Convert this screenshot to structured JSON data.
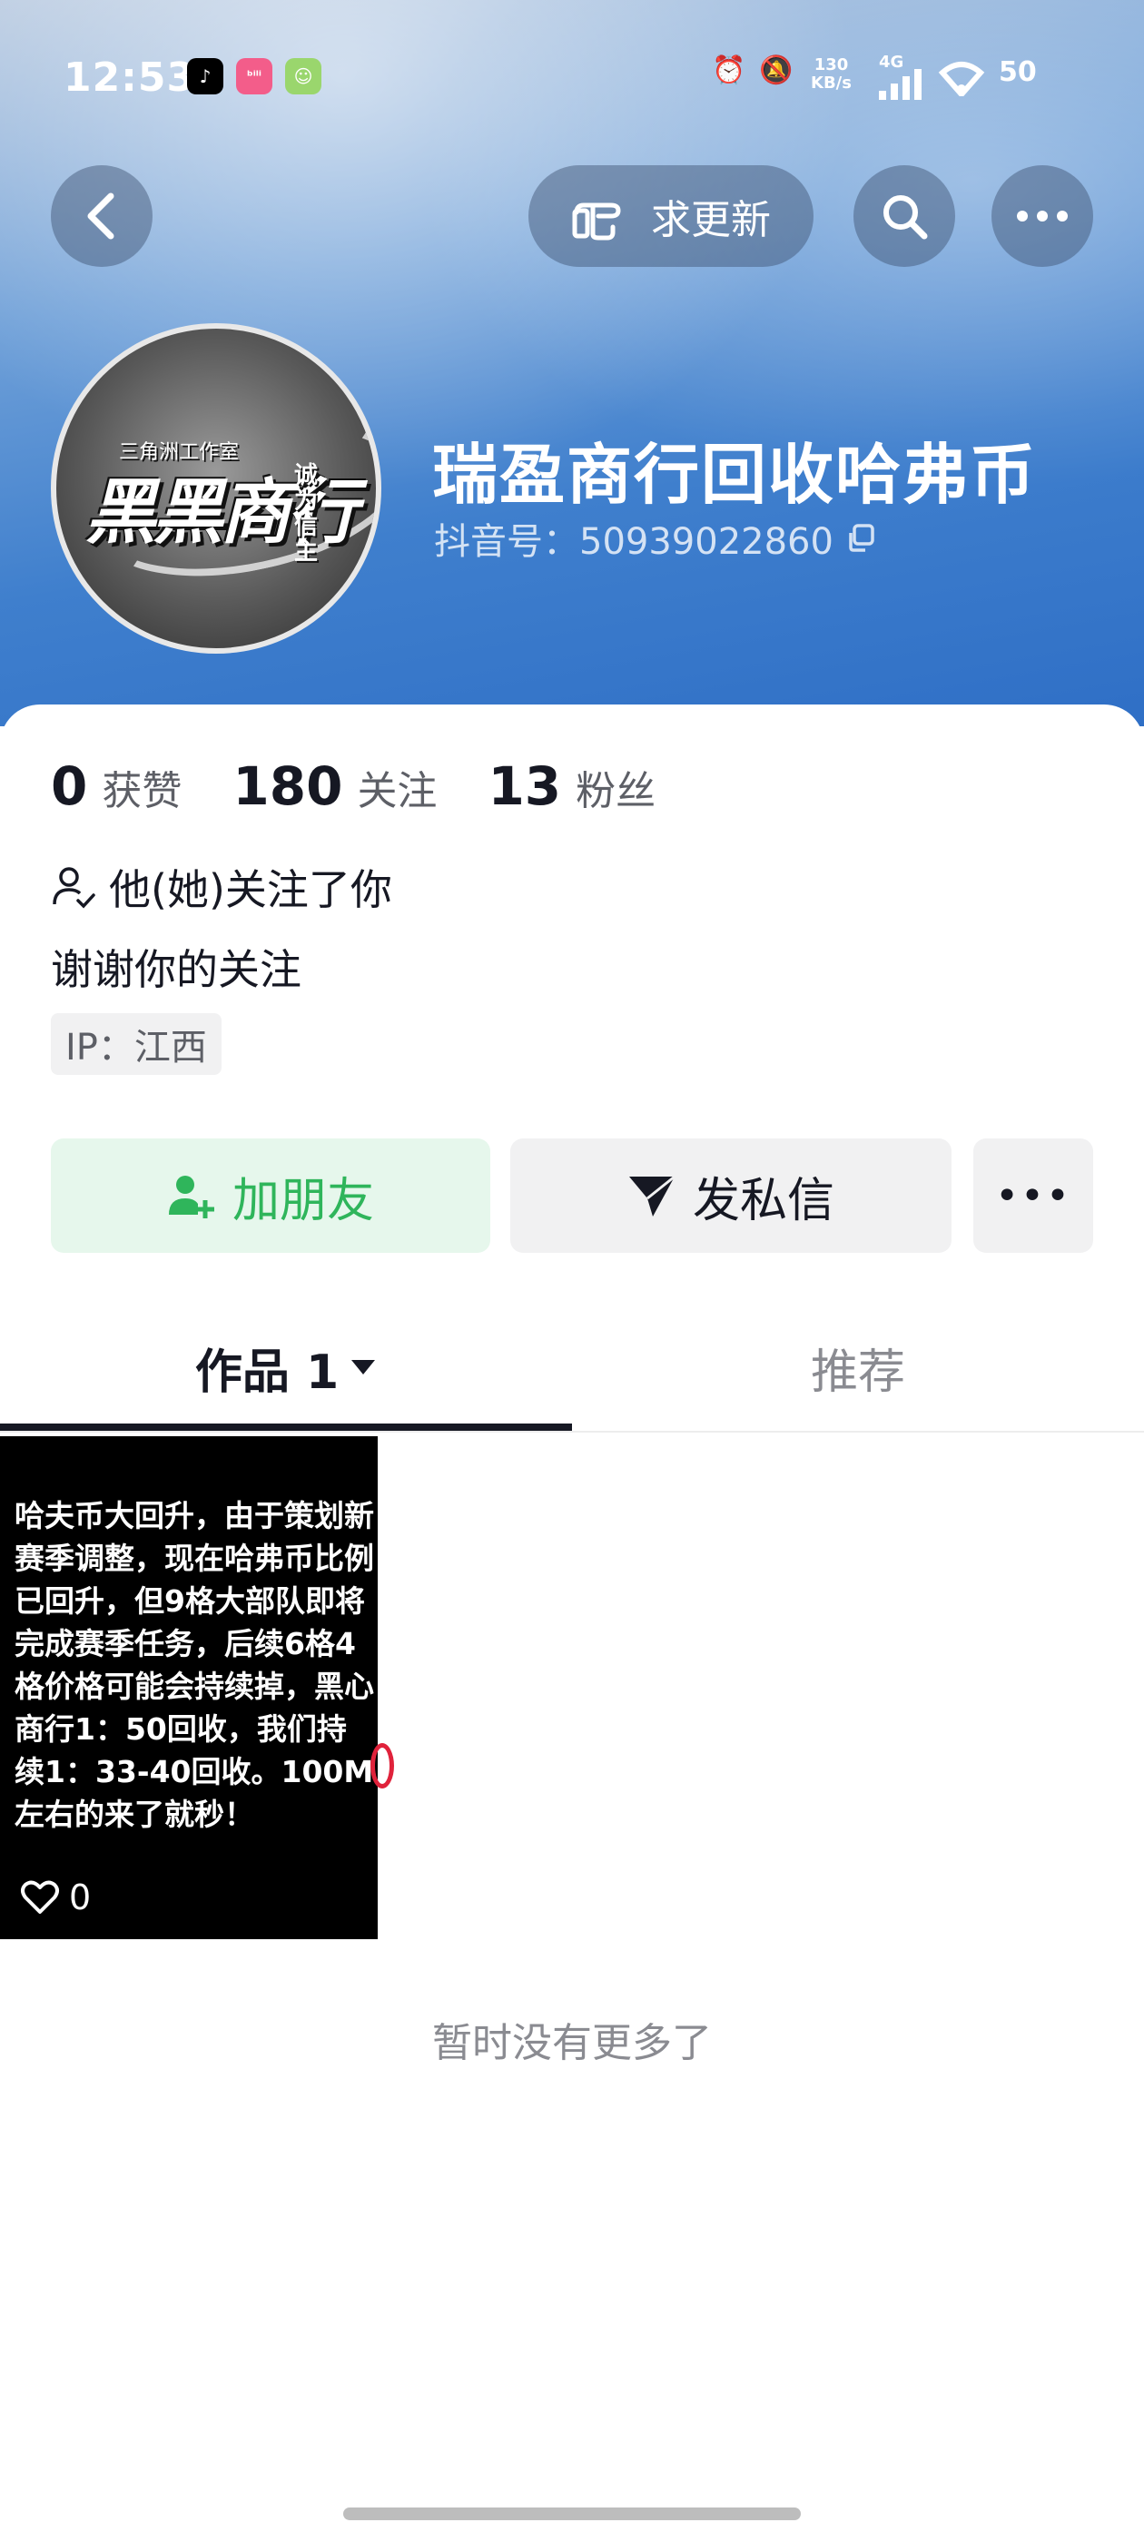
{
  "status_bar": {
    "time": "12:53",
    "net_speed_value": "130",
    "net_speed_unit": "KB/s",
    "network_type": "4G",
    "battery": "50",
    "apps": [
      "tiktok-icon",
      "bilibili-icon",
      "chat-app-icon"
    ]
  },
  "header": {
    "update_label": "求更新"
  },
  "profile": {
    "name": "瑞盈商行回收哈弗币",
    "douyin_id": "抖音号：50939022860",
    "avatar": {
      "studio_text": "三角洲工作室",
      "brand_text": "黑黑商行",
      "tag_text": "诚为信主"
    }
  },
  "stats": [
    {
      "value": "0",
      "label": "获赞"
    },
    {
      "value": "180",
      "label": "关注"
    },
    {
      "value": "13",
      "label": "粉丝"
    }
  ],
  "follow_note": "他(她)关注了你",
  "bio": "谢谢你的关注",
  "ip": "IP：江西",
  "actions": {
    "add_friend": "加朋友",
    "message": "发私信",
    "more": "•••"
  },
  "tabs": {
    "works": "作品 1",
    "recommend": "推荐"
  },
  "videos": [
    {
      "text": "哈夫币大回升，由于策划新赛季调整，现在哈弗币比例已回升，但9格大部队即将完成赛季任务，后续6格4格价格可能会持续掉，黑心商行1：50回收，我们持续1：33-40回收。100M左右的来了就秒！",
      "likes": "0"
    }
  ],
  "no_more": "暂时没有更多了",
  "colors": {
    "accent_green": "#2fb55b",
    "text_primary": "#161823",
    "text_secondary": "#8a8b91"
  }
}
